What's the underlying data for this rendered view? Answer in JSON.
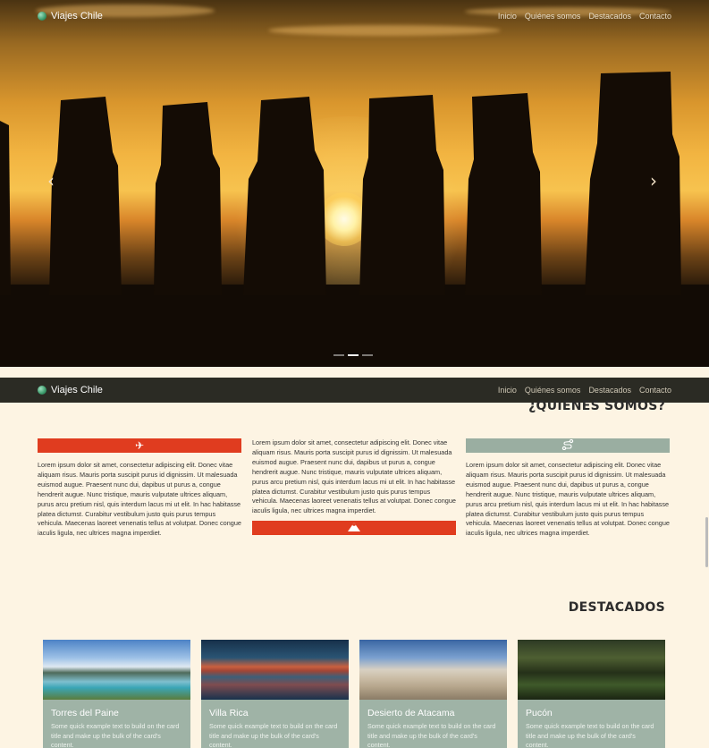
{
  "brand": {
    "name": "Viajes Chile",
    "logo_icon": "globe-icon"
  },
  "nav": {
    "items": [
      "Inicio",
      "Quiénes somos",
      "Destacados",
      "Contacto"
    ]
  },
  "carousel": {
    "prev_symbol": "‹",
    "next_symbol": "›",
    "slides": 3,
    "active_slide": 2
  },
  "quienes_somos": {
    "title": "¿QUIÉNES SOMOS?",
    "col1": {
      "icon": "airplane-icon",
      "color": "#e03c1f",
      "text": "Lorem ipsum dolor sit amet, consectetur adipiscing elit. Donec vitae aliquam risus. Mauris porta suscipit purus id dignissim. Ut malesuada euismod augue. Praesent nunc dui, dapibus ut purus a, congue hendrerit augue. Nunc tristique, mauris vulputate ultrices aliquam, purus arcu pretium nisl, quis interdum lacus mi ut elit. In hac habitasse platea dictumst. Curabitur vestibulum justo quis purus tempus vehicula. Maecenas laoreet venenatis tellus at volutpat. Donec congue iaculis ligula, nec ultrices magna imperdiet."
    },
    "col2": {
      "icon": "mountain-icon",
      "color": "#e03c1f",
      "text": "Lorem ipsum dolor sit amet, consectetur adipiscing elit. Donec vitae aliquam risus. Mauris porta suscipit purus id dignissim. Ut malesuada euismod augue. Praesent nunc dui, dapibus ut purus a, congue hendrerit augue. Nunc tristique, mauris vulputate ultrices aliquam, purus arcu pretium nisl, quis interdum lacus mi ut elit. In hac habitasse platea dictumst. Curabitur vestibulum justo quis purus tempus vehicula. Maecenas laoreet venenatis tellus at volutpat. Donec congue iaculis ligula, nec ultrices magna imperdiet."
    },
    "col3": {
      "icon": "route-icon",
      "color": "#9aaea1",
      "text": "Lorem ipsum dolor sit amet, consectetur adipiscing elit. Donec vitae aliquam risus. Mauris porta suscipit purus id dignissim. Ut malesuada euismod augue. Praesent nunc dui, dapibus ut purus a, congue hendrerit augue. Nunc tristique, mauris vulputate ultrices aliquam, purus arcu pretium nisl, quis interdum lacus mi ut elit. In hac habitasse platea dictumst. Curabitur vestibulum justo quis purus tempus vehicula. Maecenas laoreet venenatis tellus at volutpat. Donec congue iaculis ligula, nec ultrices magna imperdiet."
    }
  },
  "destacados": {
    "title": "DESTACADOS",
    "cards": [
      {
        "title": "Torres del Paine",
        "text": "Some quick example text to build on the card title and make up the bulk of the card's content."
      },
      {
        "title": "Villa Rica",
        "text": "Some quick example text to build on the card title and make up the bulk of the card's content."
      },
      {
        "title": "Desierto de Atacama",
        "text": "Some quick example text to build on the card title and make up the bulk of the card's content."
      },
      {
        "title": "Pucón",
        "text": "Some quick example text to build on the card title and make up the bulk of the card's content."
      }
    ]
  },
  "colors": {
    "background": "#fdf4e3",
    "accent_red": "#e03c1f",
    "accent_sage": "#9aaea1",
    "navbar_dark": "#2b2b24"
  }
}
